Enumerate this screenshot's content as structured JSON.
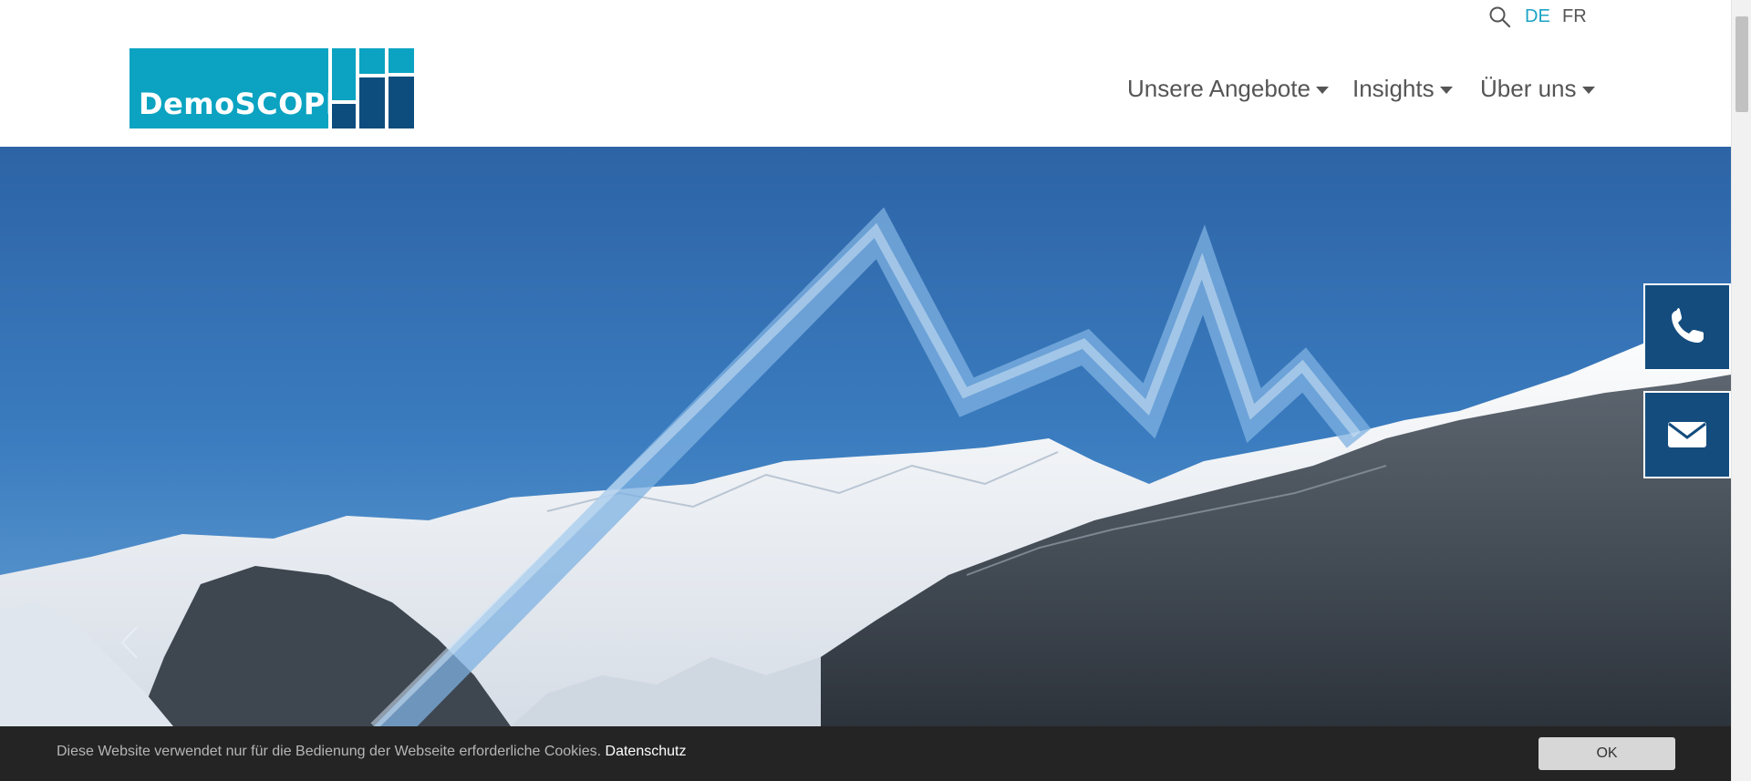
{
  "header": {
    "languages": [
      {
        "code": "DE",
        "active": true
      },
      {
        "code": "FR",
        "active": false
      }
    ],
    "logo": {
      "text": "DemoSCOPE",
      "colors": {
        "light": "#0ba3c1",
        "dark": "#0d4d7e"
      }
    },
    "nav": [
      {
        "label": "Unsere Angebote"
      },
      {
        "label": "Insights"
      },
      {
        "label": "Über uns"
      }
    ],
    "icons": {
      "search": "search-icon"
    }
  },
  "hero": {
    "image": "snowy-mountains-with-rising-chart-line",
    "prev_icon": "chevron-left-icon"
  },
  "contact": {
    "phone_icon": "phone-icon",
    "mail_icon": "envelope-icon",
    "color": "#144c7e"
  },
  "cookie": {
    "text": "Diese Website verwendet nur für die Bedienung der Webseite erforderliche Cookies.",
    "link": "Datenschutz",
    "ok_label": "OK"
  },
  "colors": {
    "accent": "#1aa3c6",
    "nav_text": "#555555",
    "cookie_bg": "#242424"
  }
}
